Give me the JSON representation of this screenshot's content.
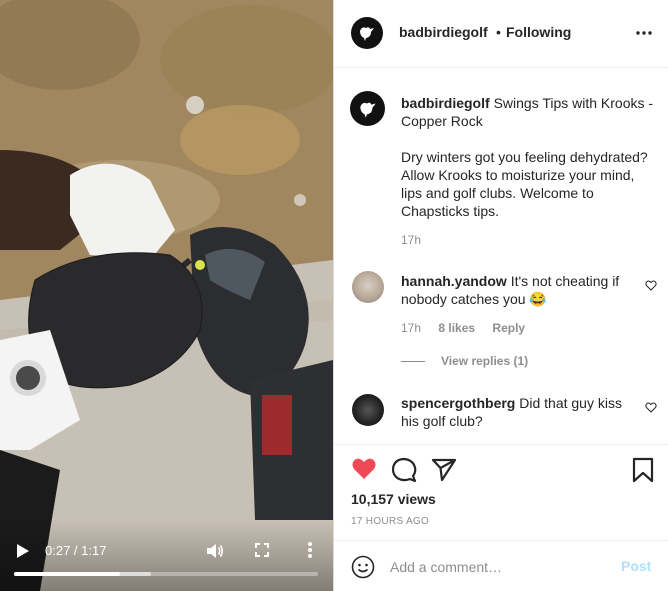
{
  "video": {
    "current_time": "0:27",
    "separator": " / ",
    "duration": "1:17",
    "progress_fraction": 0.35,
    "buffered_fraction": 0.45
  },
  "header": {
    "username": "badbirdiegolf",
    "dot": "•",
    "follow_status": "Following",
    "more_icon": "more-horizontal-icon"
  },
  "caption": {
    "username": "badbirdiegolf",
    "title": "Swings Tips with Krooks - Copper Rock",
    "body": "Dry winters got you feeling dehydrated? Allow Krooks to moisturize your mind, lips and golf clubs. Welcome to Chapsticks tips.",
    "time": "17h"
  },
  "comments": [
    {
      "username": "hannah.yandow",
      "text": "It's not cheating if nobody catches you 😂",
      "time": "17h",
      "likes": "8 likes",
      "reply": "Reply",
      "view_replies": "View replies (1)"
    },
    {
      "username": "spencergothberg",
      "text": "Did that guy kiss his golf club?"
    }
  ],
  "actions": {
    "liked": true,
    "like_color": "#ed4956",
    "views": "10,157 views",
    "date": "17 HOURS AGO"
  },
  "add_comment": {
    "placeholder": "Add a comment…",
    "post_label": "Post",
    "post_color": "#b2dffc"
  }
}
